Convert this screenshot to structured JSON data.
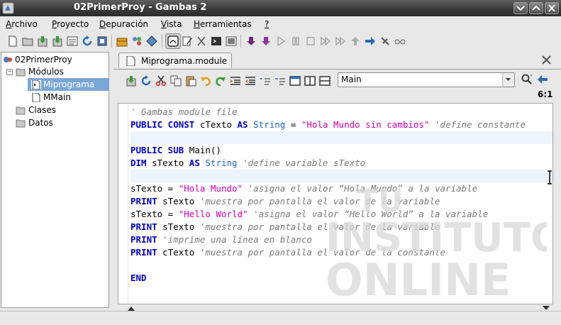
{
  "window": {
    "title": "02PrimerProy - Gambas 2",
    "minimize_icon": "chevron-down-icon",
    "maximize_icon": "chevron-up-icon",
    "close_icon": "close-icon"
  },
  "menubar": {
    "items": [
      {
        "label": "Archivo",
        "mnemonic": "A"
      },
      {
        "label": "Proyecto",
        "mnemonic": "P"
      },
      {
        "label": "Depuración",
        "mnemonic": "D"
      },
      {
        "label": "Vista",
        "mnemonic": "V"
      },
      {
        "label": "Herramientas",
        "mnemonic": "H"
      },
      {
        "label": "?",
        "mnemonic": "?"
      }
    ]
  },
  "project_tree": {
    "root": "02PrimerProy",
    "nodes": [
      {
        "label": "Módulos"
      },
      {
        "label": "Miprograma"
      },
      {
        "label": "MMain"
      },
      {
        "label": "Clases"
      },
      {
        "label": "Datos"
      }
    ]
  },
  "editor": {
    "tab_title": "Miprograma.module",
    "procedure_combo": "Main",
    "cursor_position": "6:1",
    "code": {
      "l1_comment": "' Gambas module file",
      "l2_kw1": "PUBLIC CONST",
      "l2_id": "cTexto",
      "l2_kw2": "AS",
      "l2_type": "String",
      "l2_eq": "=",
      "l2_str": "\"Hola Mundo sin cambios\"",
      "l2_comment": "'define constante",
      "l4_kw": "PUBLIC SUB",
      "l4_id": "Main()",
      "l5_kw": "DIM",
      "l5_id": "sTexto",
      "l5_kw2": "AS",
      "l5_type": "String",
      "l5_comment": "'define variable sTexto",
      "l7_id": "sTexto =",
      "l7_str": "\"Hola Mundo\"",
      "l7_comment": "'asigna el valor “Hola Mundo” a la variable",
      "l8_kw": "PRINT",
      "l8_id": "sTexto",
      "l8_comment": "'muestra por pantalla el valor de la variable",
      "l9_id": "sTexto =",
      "l9_str": "\"Hello World\"",
      "l9_comment": "'asigna el valor “Hello World” a la variable",
      "l10_kw": "PRINT",
      "l10_id": "sTexto",
      "l10_comment": "'muestra por pantalla el valor de la variable",
      "l11_kw": "PRINT",
      "l11_comment": "'imprime una línea en blanco",
      "l12_kw": "PRINT",
      "l12_id": "cTexto",
      "l12_comment": "'muestra por pantalla el valor de la constante",
      "l14_kw": "END"
    }
  },
  "watermark": {
    "line1": "TU",
    "line2": "INSTITUTO",
    "line3": "ONLINE"
  },
  "colors": {
    "keyword": "#0000c0",
    "type": "#2060d0",
    "string": "#d000b0",
    "comment": "#7a7a7a",
    "selection": "#7aa7d6"
  }
}
